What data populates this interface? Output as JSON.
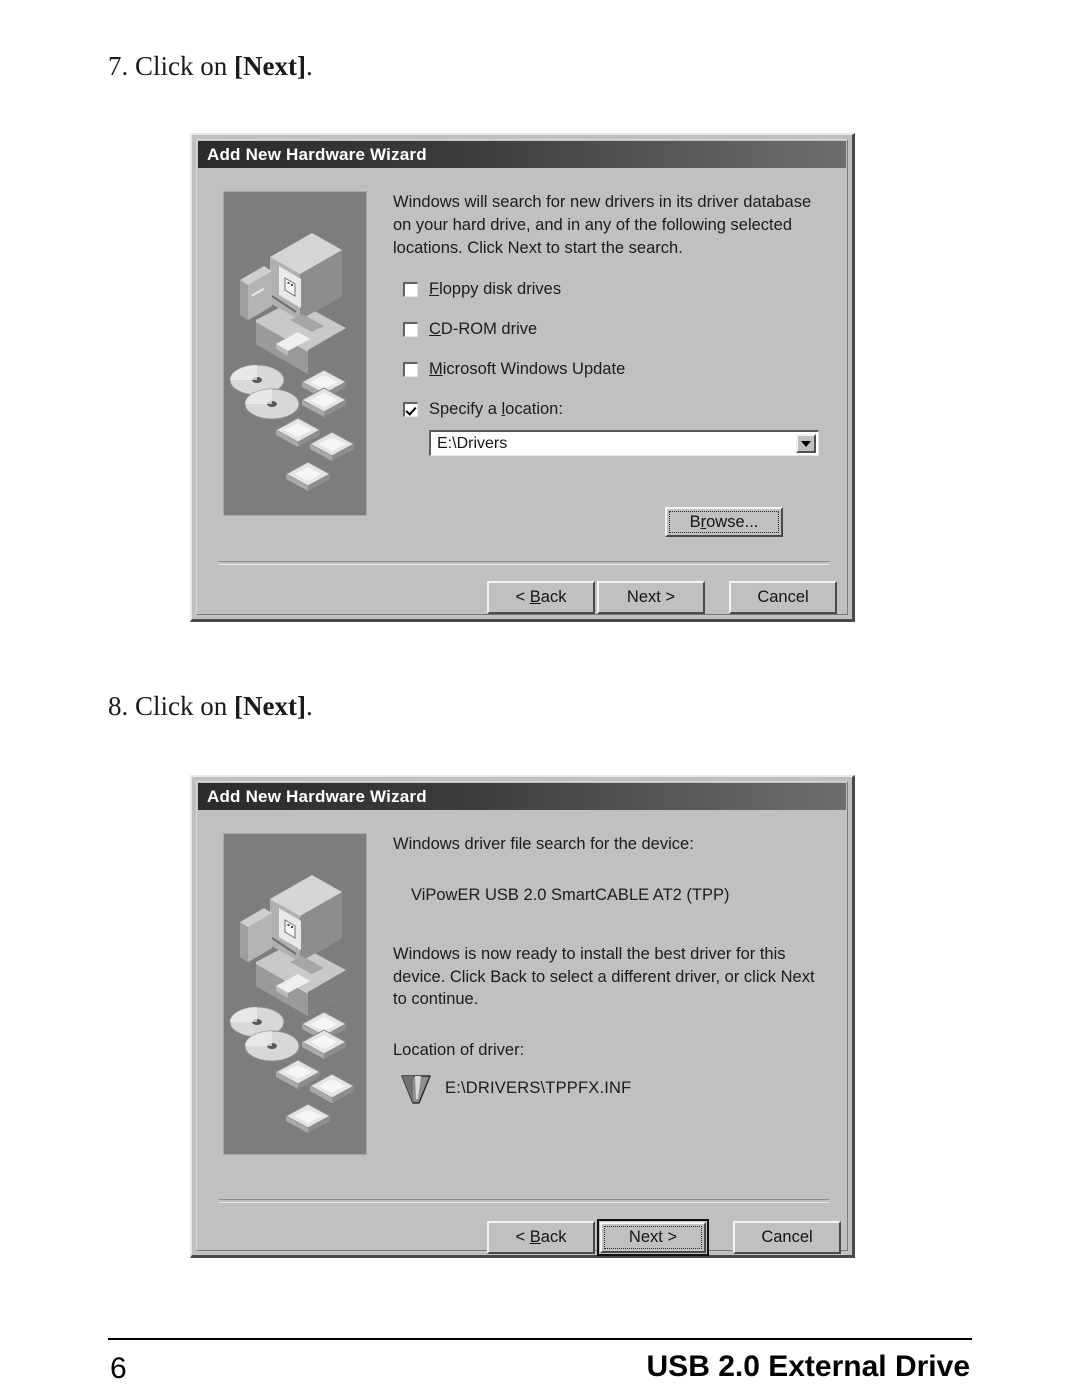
{
  "document": {
    "steps": [
      {
        "number": "7.",
        "text_before": "Click on ",
        "emphasis": "[Next]",
        "text_after": "."
      },
      {
        "number": "8.",
        "text_before": "Click on ",
        "emphasis": "[Next]",
        "text_after": "."
      }
    ],
    "footer": {
      "page_number": "6",
      "title": "USB 2.0 External Drive"
    }
  },
  "dialog1": {
    "title": "Add New Hardware Wizard",
    "illustration": "computer-cds-chips-illustration",
    "body_text": "Windows will search for new drivers in its driver database on your hard drive, and in any of the following selected locations. Click Next to start the search.",
    "checkboxes": [
      {
        "label": "Floppy disk drives",
        "accelerator": "F",
        "checked": false
      },
      {
        "label": "CD-ROM drive",
        "accelerator": "C",
        "checked": false
      },
      {
        "label": "Microsoft Windows Update",
        "accelerator": "M",
        "checked": false
      },
      {
        "label": "Specify a location:",
        "accelerator": "l",
        "checked": true
      }
    ],
    "location_combo": {
      "value": "E:\\Drivers",
      "arrow_icon": "chevron-down-icon"
    },
    "browse_button": {
      "label": "Browse...",
      "accelerator": "r",
      "focused": true
    },
    "buttons": [
      {
        "label": "< Back",
        "accelerator": "B",
        "default": false
      },
      {
        "label": "Next >",
        "accelerator": "",
        "default": false
      },
      {
        "label": "Cancel",
        "accelerator": "",
        "default": false
      }
    ]
  },
  "dialog2": {
    "title": "Add New Hardware Wizard",
    "illustration": "computer-cds-chips-illustration",
    "search_heading": "Windows driver file search for the device:",
    "device_name": "ViPowER USB 2.0 SmartCABLE AT2 (TPP)",
    "ready_text": "Windows is now ready to install the best driver for this device. Click Back to select a different driver, or click Next to continue.",
    "location_label": "Location of driver:",
    "driver_path": "E:\\DRIVERS\\TPPFX.INF",
    "driver_icon": "funnel-icon",
    "buttons": [
      {
        "label": "< Back",
        "accelerator": "B",
        "default": false
      },
      {
        "label": "Next >",
        "accelerator": "",
        "default": true
      },
      {
        "label": "Cancel",
        "accelerator": "",
        "default": false
      }
    ]
  },
  "colors": {
    "dialog_face": "#c0c0c0",
    "titlebar_dark": "#2b2b2b",
    "titlebar_light": "#6e6e6e",
    "illustration_bg": "#7d7d7d",
    "text": "#1c1c1c",
    "field_bg": "#ffffff"
  }
}
